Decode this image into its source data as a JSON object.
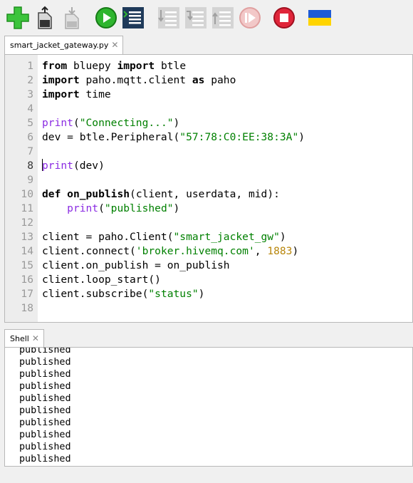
{
  "toolbar": {
    "buttons": [
      {
        "name": "new-button",
        "icon": "plus-icon"
      },
      {
        "name": "open-button",
        "icon": "open-file-icon"
      },
      {
        "name": "save-button",
        "icon": "save-icon"
      },
      {
        "name": "run-button",
        "icon": "play-icon"
      },
      {
        "name": "debug-button",
        "icon": "debug-list-icon"
      },
      {
        "name": "step-over-button",
        "icon": "step-over-icon"
      },
      {
        "name": "step-into-button",
        "icon": "step-into-icon"
      },
      {
        "name": "step-out-button",
        "icon": "step-out-icon"
      },
      {
        "name": "resume-button",
        "icon": "resume-icon"
      },
      {
        "name": "stop-button",
        "icon": "stop-icon"
      },
      {
        "name": "ukraine-flag",
        "icon": "ukraine-flag-icon"
      }
    ]
  },
  "editor": {
    "tab_label": "smart_jacket_gateway.py",
    "tab_close": "✕",
    "current_line": 8,
    "line_numbers": [
      "1",
      "2",
      "3",
      "4",
      "5",
      "6",
      "7",
      "8",
      "9",
      "10",
      "11",
      "12",
      "13",
      "14",
      "15",
      "16",
      "17",
      "18"
    ],
    "lines": [
      "from bluepy import btle",
      "import paho.mqtt.client as paho",
      "import time",
      "",
      "print(\"Connecting...\")",
      "dev = btle.Peripheral(\"57:78:C0:EE:38:3A\")",
      "",
      "print(dev)",
      "",
      "def on_publish(client, userdata, mid):",
      "    print(\"published\")",
      "",
      "client = paho.Client(\"smart_jacket_gw\")",
      "client.connect('broker.hivemq.com', 1883)",
      "client.on_publish = on_publish",
      "client.loop_start()",
      "client.subscribe(\"status\")",
      ""
    ]
  },
  "shell": {
    "tab_label": "Shell",
    "tab_close": "✕",
    "output": [
      "published",
      "published",
      "published",
      "published",
      "published",
      "published",
      "published",
      "published",
      "published",
      "published"
    ]
  },
  "colors": {
    "keyword": "#000000",
    "builtin": "#8a2be2",
    "string": "#008000",
    "number": "#b8860b",
    "gutter_bg": "#ededed"
  }
}
